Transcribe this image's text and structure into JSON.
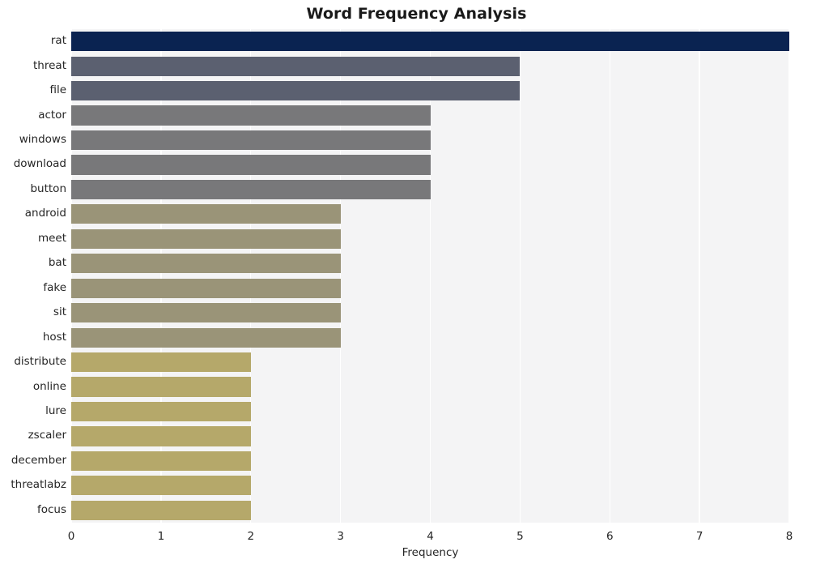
{
  "chart_data": {
    "type": "bar",
    "orientation": "horizontal",
    "title": "Word Frequency Analysis",
    "xlabel": "Frequency",
    "ylabel": "",
    "categories": [
      "rat",
      "threat",
      "file",
      "actor",
      "windows",
      "download",
      "button",
      "android",
      "meet",
      "bat",
      "fake",
      "sit",
      "host",
      "distribute",
      "online",
      "lure",
      "zscaler",
      "december",
      "threatlabz",
      "focus"
    ],
    "values": [
      8,
      5,
      5,
      4,
      4,
      4,
      4,
      3,
      3,
      3,
      3,
      3,
      3,
      2,
      2,
      2,
      2,
      2,
      2,
      2
    ],
    "bar_colors": [
      "#0a2351",
      "#5b6070",
      "#5b6070",
      "#78787a",
      "#78787a",
      "#78787a",
      "#78787a",
      "#9a9478",
      "#9a9478",
      "#9a9478",
      "#9a9478",
      "#9a9478",
      "#9a9478",
      "#b5a86a",
      "#b5a86a",
      "#b5a86a",
      "#b5a86a",
      "#b5a86a",
      "#b5a86a",
      "#b5a86a"
    ],
    "xlim": [
      0,
      8
    ],
    "xticks": [
      "0",
      "1",
      "2",
      "3",
      "4",
      "5",
      "6",
      "7",
      "8"
    ],
    "xtick_values": [
      0,
      1,
      2,
      3,
      4,
      5,
      6,
      7,
      8
    ],
    "grid": true,
    "grid_axis": "x",
    "grid_color": "#ffffff",
    "plot_background": "#f4f4f5",
    "figure_background": "#ffffff",
    "legend": null
  }
}
